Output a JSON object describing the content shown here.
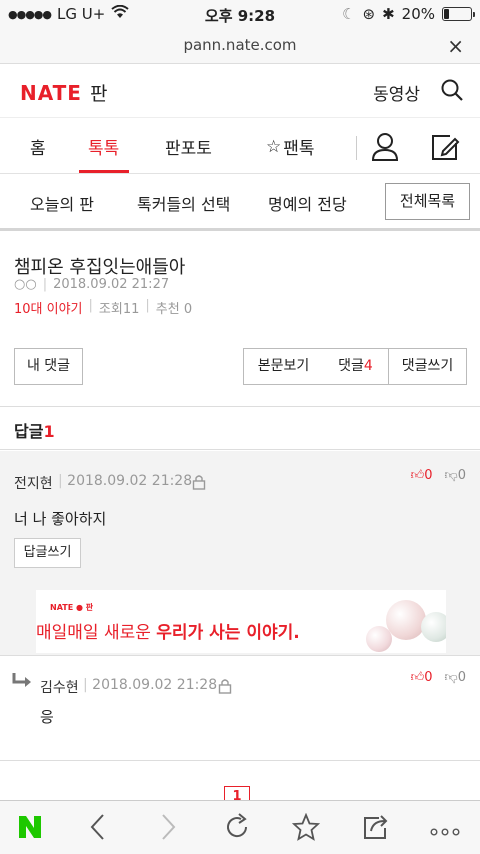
{
  "status": {
    "carrier": "LG U+",
    "time": "오후 9:28",
    "battery": "20%",
    "battery_level": 0.2
  },
  "browser": {
    "url": "pann.nate.com",
    "close": "×"
  },
  "header": {
    "logo": "NATE",
    "logo_sub": "판",
    "video": "동영상"
  },
  "tabs": {
    "home": "홈",
    "toktok": "톡톡",
    "panpoto": "판포토",
    "pantok": "팬톡"
  },
  "subnav": {
    "today": "오늘의 판",
    "talker": "톡커들의 선택",
    "honor": "명예의 전당",
    "all": "전체목록"
  },
  "post": {
    "title": "챔피온 후집잇는애들아",
    "author": "○○",
    "date": "2018.09.02 21:27",
    "category": "10대 이야기",
    "views_label": "조회",
    "views": "11",
    "recommend_label": "추천",
    "recommend": "0"
  },
  "actions": {
    "my_comments": "내 댓글",
    "view_body": "본문보기",
    "comments_label": "댓글",
    "comments_count": "4",
    "write_comment": "댓글쓰기"
  },
  "replies": {
    "label": "답글",
    "count": "1"
  },
  "comments": [
    {
      "author": "전지현",
      "date": "2018.09.02 21:28",
      "text": "너 나 좋아하지",
      "up": "0",
      "down": "0",
      "reply_button": "답글쓰기"
    },
    {
      "author": "김수현",
      "date": "2018.09.02 21:28",
      "text": "응",
      "up": "0",
      "down": "0"
    }
  ],
  "banner": {
    "brand": "NATE ● 판",
    "line_normal": "매일매일 새로운 ",
    "line_bold": "우리가 사는 이야기."
  },
  "pagination": {
    "current": "1"
  }
}
